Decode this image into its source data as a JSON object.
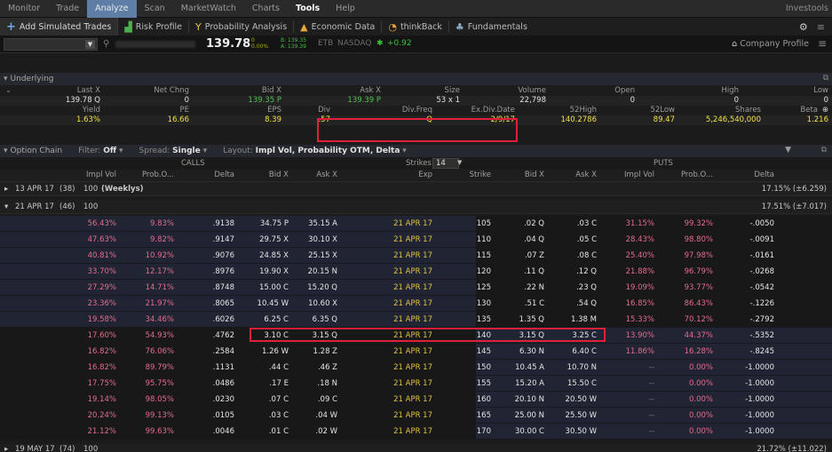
{
  "menu": {
    "items": [
      "Monitor",
      "Trade",
      "Analyze",
      "Scan",
      "MarketWatch",
      "Charts",
      "Tools",
      "Help"
    ],
    "active": "Analyze",
    "right": "Investools"
  },
  "toolbar": {
    "add_label": "Add Simulated Trades",
    "risk_label": "Risk Profile",
    "prob_label": "Probability Analysis",
    "econ_label": "Economic Data",
    "thinkback_label": "thinkBack",
    "fund_label": "Fundamentals"
  },
  "quote": {
    "last": "139.78",
    "change_top": "0",
    "change_bottom": "0.00%",
    "bid_line": "B: 139.35",
    "ask_line": "A: 139.39",
    "exchange1": "ETB",
    "exchange2": "NASDAQ",
    "plusval": "+0.92",
    "company_profile": "Company Profile"
  },
  "underlying": {
    "label": "Underlying",
    "headers1": [
      "Last X",
      "Net Chng",
      "Bid X",
      "Ask X",
      "Size",
      "Volume",
      "Open",
      "High",
      "Low"
    ],
    "values1": [
      "139.78 Q",
      "0",
      "139.35 P",
      "139.39 P",
      "53 x 1",
      "22,798",
      "0",
      "0",
      "0"
    ],
    "headers2": [
      "Yield",
      "PE",
      "EPS",
      "Div",
      "Div.Freq",
      "Ex.Div.Date",
      "52High",
      "52Low",
      "Shares",
      "Beta"
    ],
    "values2": [
      "1.63%",
      "16.66",
      "8.39",
      ".57",
      "Q",
      "2/9/17",
      "140.2786",
      "89.47",
      "5,246,540,000",
      "1.216"
    ]
  },
  "chain": {
    "label": "Option Chain",
    "filter_label": "Filter:",
    "filter_val": "Off",
    "spread_label": "Spread:",
    "spread_val": "Single",
    "layout_label": "Layout:",
    "layout_val": "Impl Vol, Probability OTM, Delta",
    "calls": "CALLS",
    "puts": "PUTS",
    "strikes_label": "Strikes:",
    "strikes_val": "14",
    "col_headers": [
      "Impl Vol",
      "Prob.O...",
      "Delta",
      "Bid X",
      "Ask X",
      "Exp",
      "Strike",
      "Bid X",
      "Ask X",
      "Impl Vol",
      "Prob.O...",
      "Delta"
    ],
    "exp1": {
      "date": "13 APR 17",
      "days": "(38)",
      "count": "100",
      "tag": "(Weeklys)",
      "iv": "17.15% (±6.259)"
    },
    "exp2": {
      "date": "21 APR 17",
      "days": "(46)",
      "count": "100",
      "iv": "17.51% (±7.017)"
    },
    "exp3": {
      "date": "19 MAY 17",
      "days": "(74)",
      "count": "100",
      "iv": "21.72% (±11.022)"
    },
    "rows": [
      [
        "56.43%",
        "9.83%",
        ".9138",
        "34.75 P",
        "35.15 A",
        "21 APR 17",
        "105",
        ".02 Q",
        ".03 C",
        "31.15%",
        "99.32%",
        "-.0050"
      ],
      [
        "47.63%",
        "9.82%",
        ".9147",
        "29.75 X",
        "30.10 X",
        "21 APR 17",
        "110",
        ".04 Q",
        ".05 C",
        "28.43%",
        "98.80%",
        "-.0091"
      ],
      [
        "40.81%",
        "10.92%",
        ".9076",
        "24.85 X",
        "25.15 X",
        "21 APR 17",
        "115",
        ".07 Z",
        ".08 C",
        "25.40%",
        "97.98%",
        "-.0161"
      ],
      [
        "33.70%",
        "12.17%",
        ".8976",
        "19.90 X",
        "20.15 N",
        "21 APR 17",
        "120",
        ".11 Q",
        ".12 Q",
        "21.88%",
        "96.79%",
        "-.0268"
      ],
      [
        "27.29%",
        "14.71%",
        ".8748",
        "15.00 C",
        "15.20 Q",
        "21 APR 17",
        "125",
        ".22 N",
        ".23 Q",
        "19.09%",
        "93.77%",
        "-.0542"
      ],
      [
        "23.36%",
        "21.97%",
        ".8065",
        "10.45 W",
        "10.60 X",
        "21 APR 17",
        "130",
        ".51 C",
        ".54 Q",
        "16.85%",
        "86.43%",
        "-.1226"
      ],
      [
        "19.58%",
        "34.46%",
        ".6026",
        "6.25 C",
        "6.35 Q",
        "21 APR 17",
        "135",
        "1.35 Q",
        "1.38 M",
        "15.33%",
        "70.12%",
        "-.2792"
      ],
      [
        "17.60%",
        "54.93%",
        ".4762",
        "3.10 C",
        "3.15 Q",
        "21 APR 17",
        "140",
        "3.15 Q",
        "3.25 C",
        "13.90%",
        "44.37%",
        "-.5352"
      ],
      [
        "16.82%",
        "76.06%",
        ".2584",
        "1.26 W",
        "1.28 Z",
        "21 APR 17",
        "145",
        "6.30 N",
        "6.40 C",
        "11.86%",
        "16.28%",
        "-.8245"
      ],
      [
        "16.82%",
        "89.79%",
        ".1131",
        ".44 C",
        ".46 Z",
        "21 APR 17",
        "150",
        "10.45 A",
        "10.70 N",
        "--",
        "0.00%",
        "-1.0000"
      ],
      [
        "17.75%",
        "95.75%",
        ".0486",
        ".17 E",
        ".18 N",
        "21 APR 17",
        "155",
        "15.20 A",
        "15.50 C",
        "--",
        "0.00%",
        "-1.0000"
      ],
      [
        "19.14%",
        "98.05%",
        ".0230",
        ".07 C",
        ".09 C",
        "21 APR 17",
        "160",
        "20.10 N",
        "20.50 W",
        "--",
        "0.00%",
        "-1.0000"
      ],
      [
        "20.24%",
        "99.13%",
        ".0105",
        ".03 C",
        ".04 W",
        "21 APR 17",
        "165",
        "25.00 N",
        "25.50 W",
        "--",
        "0.00%",
        "-1.0000"
      ],
      [
        "21.12%",
        "99.63%",
        ".0046",
        ".01 C",
        ".02 W",
        "21 APR 17",
        "170",
        "30.00 C",
        "30.50 W",
        "--",
        "0.00%",
        "-1.0000"
      ]
    ]
  },
  "colors": {
    "accent": "#5f7ea6",
    "highlight": "#e0203a",
    "call_iv": "#e56b8e",
    "itm_bg": "#202433"
  }
}
